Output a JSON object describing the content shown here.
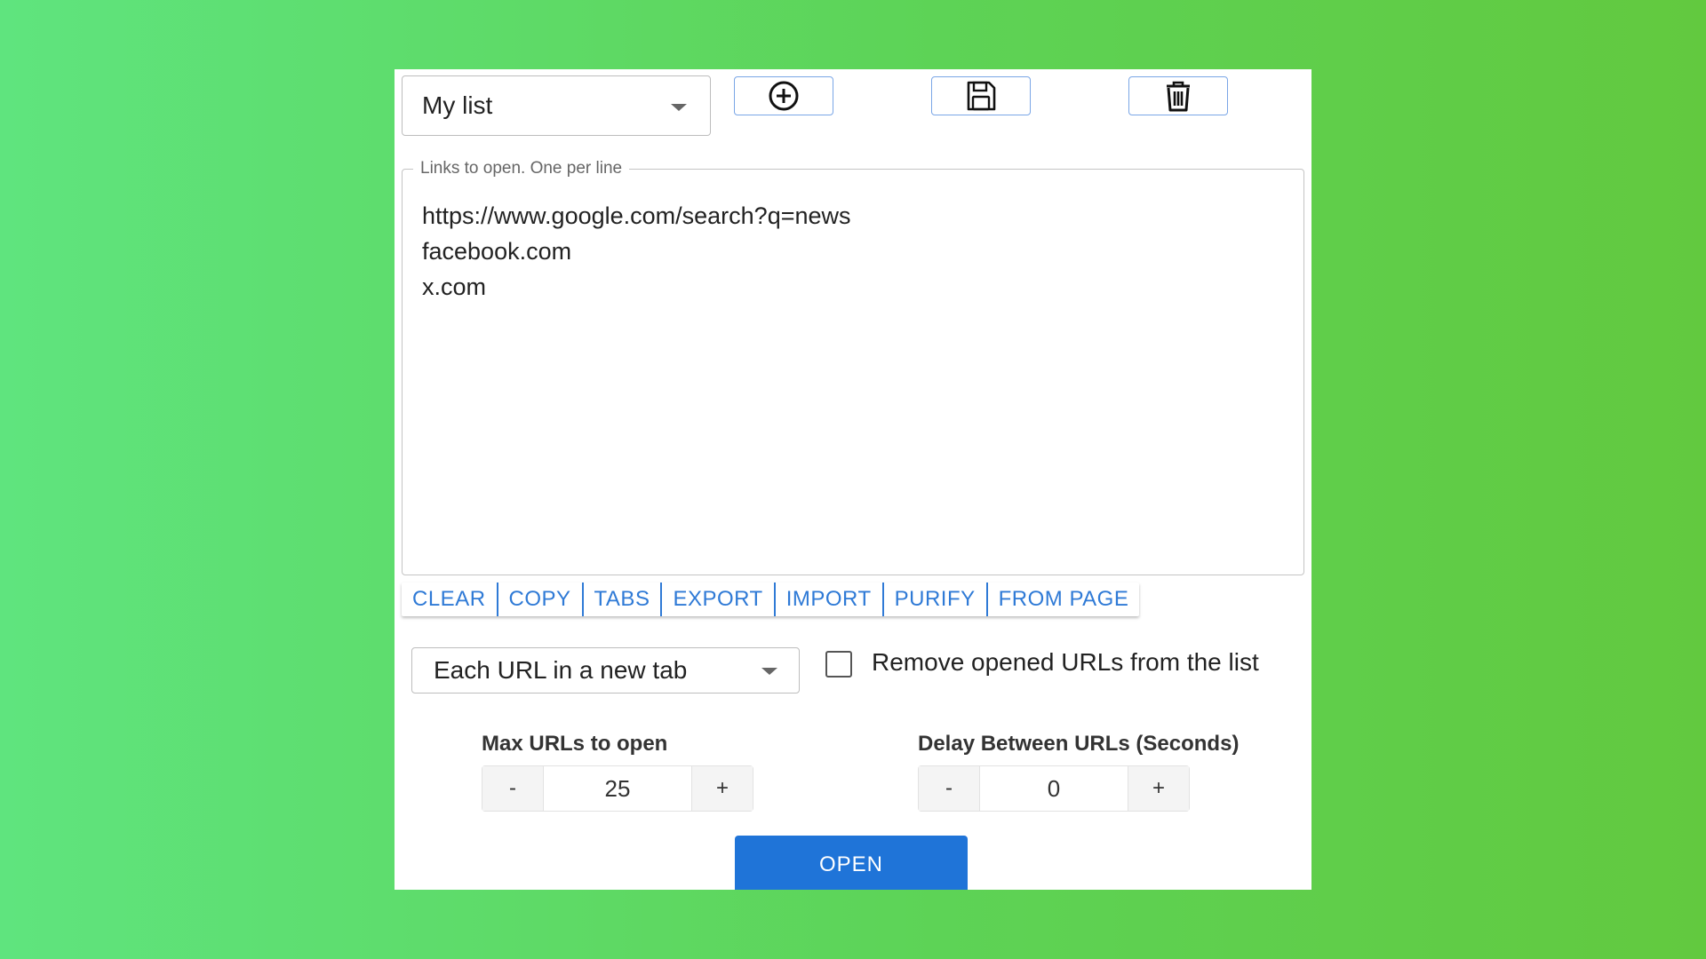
{
  "list_selector": {
    "selected": "My list",
    "icon": "chevron-down-icon"
  },
  "toolbar": {
    "add_icon": "plus-circle-icon",
    "save_icon": "floppy-disk-icon",
    "delete_icon": "trash-icon",
    "accent_color": "#7aa6e6"
  },
  "links": {
    "legend": "Links to open. One per line",
    "value": "https://www.google.com/search?q=news\nfacebook.com\nx.com"
  },
  "actions": [
    {
      "label": "CLEAR"
    },
    {
      "label": "COPY"
    },
    {
      "label": "TABS"
    },
    {
      "label": "EXPORT"
    },
    {
      "label": "IMPORT"
    },
    {
      "label": "PURIFY"
    },
    {
      "label": "FROM PAGE"
    }
  ],
  "open_mode": {
    "selected": "Each URL in a new tab"
  },
  "remove_opened": {
    "label": "Remove opened URLs from the list",
    "checked": false
  },
  "max_urls": {
    "title": "Max URLs to open",
    "minus": "-",
    "value": "25",
    "plus": "+"
  },
  "delay": {
    "title": "Delay Between URLs (Seconds)",
    "minus": "-",
    "value": "0",
    "plus": "+"
  },
  "open_button": {
    "label": "OPEN",
    "color": "#1f74d8"
  }
}
